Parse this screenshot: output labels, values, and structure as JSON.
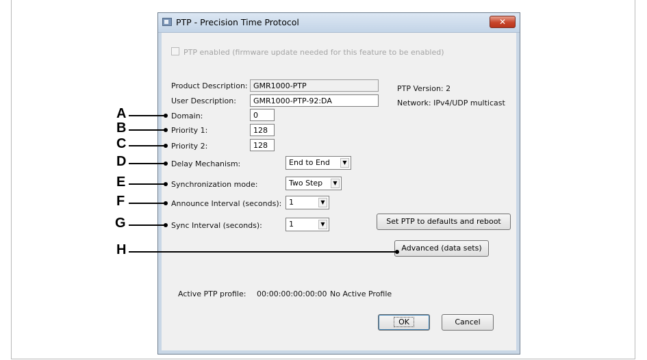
{
  "window": {
    "title": "PTP - Precision Time Protocol",
    "close_glyph": "✕",
    "icon": "app-window-icon"
  },
  "ptp_enabled": {
    "label": "PTP enabled (firmware update needed for this feature to be enabled)",
    "checked": false,
    "disabled": true
  },
  "fields": {
    "product_description_label": "Product Description:",
    "product_description_value": "GMR1000-PTP",
    "user_description_label": "User Description:",
    "user_description_value": "GMR1000-PTP-92:DA",
    "domain_label": "Domain:",
    "domain_value": "0",
    "priority1_label": "Priority 1:",
    "priority1_value": "128",
    "priority2_label": "Priority 2:",
    "priority2_value": "128"
  },
  "info": {
    "ptp_version": "PTP Version: 2",
    "network": "Network: IPv4/UDP multicast"
  },
  "selects": {
    "delay_mechanism_label": "Delay Mechanism:",
    "delay_mechanism_value": "End to End",
    "sync_mode_label": "Synchronization mode:",
    "sync_mode_value": "Two Step",
    "announce_interval_label": "Announce Interval (seconds):",
    "announce_interval_value": "1",
    "sync_interval_label": "Sync Interval (seconds):",
    "sync_interval_value": "1",
    "arrow_glyph": "▼"
  },
  "buttons": {
    "defaults_reboot": "Set PTP to defaults and reboot",
    "advanced": "Advanced (data sets)",
    "ok": "OK",
    "cancel": "Cancel"
  },
  "profile": {
    "label": "Active PTP profile:",
    "id": "00:00:00:00:00:00",
    "name": "No Active Profile"
  },
  "callouts": [
    "A",
    "B",
    "C",
    "D",
    "E",
    "F",
    "G",
    "H"
  ]
}
